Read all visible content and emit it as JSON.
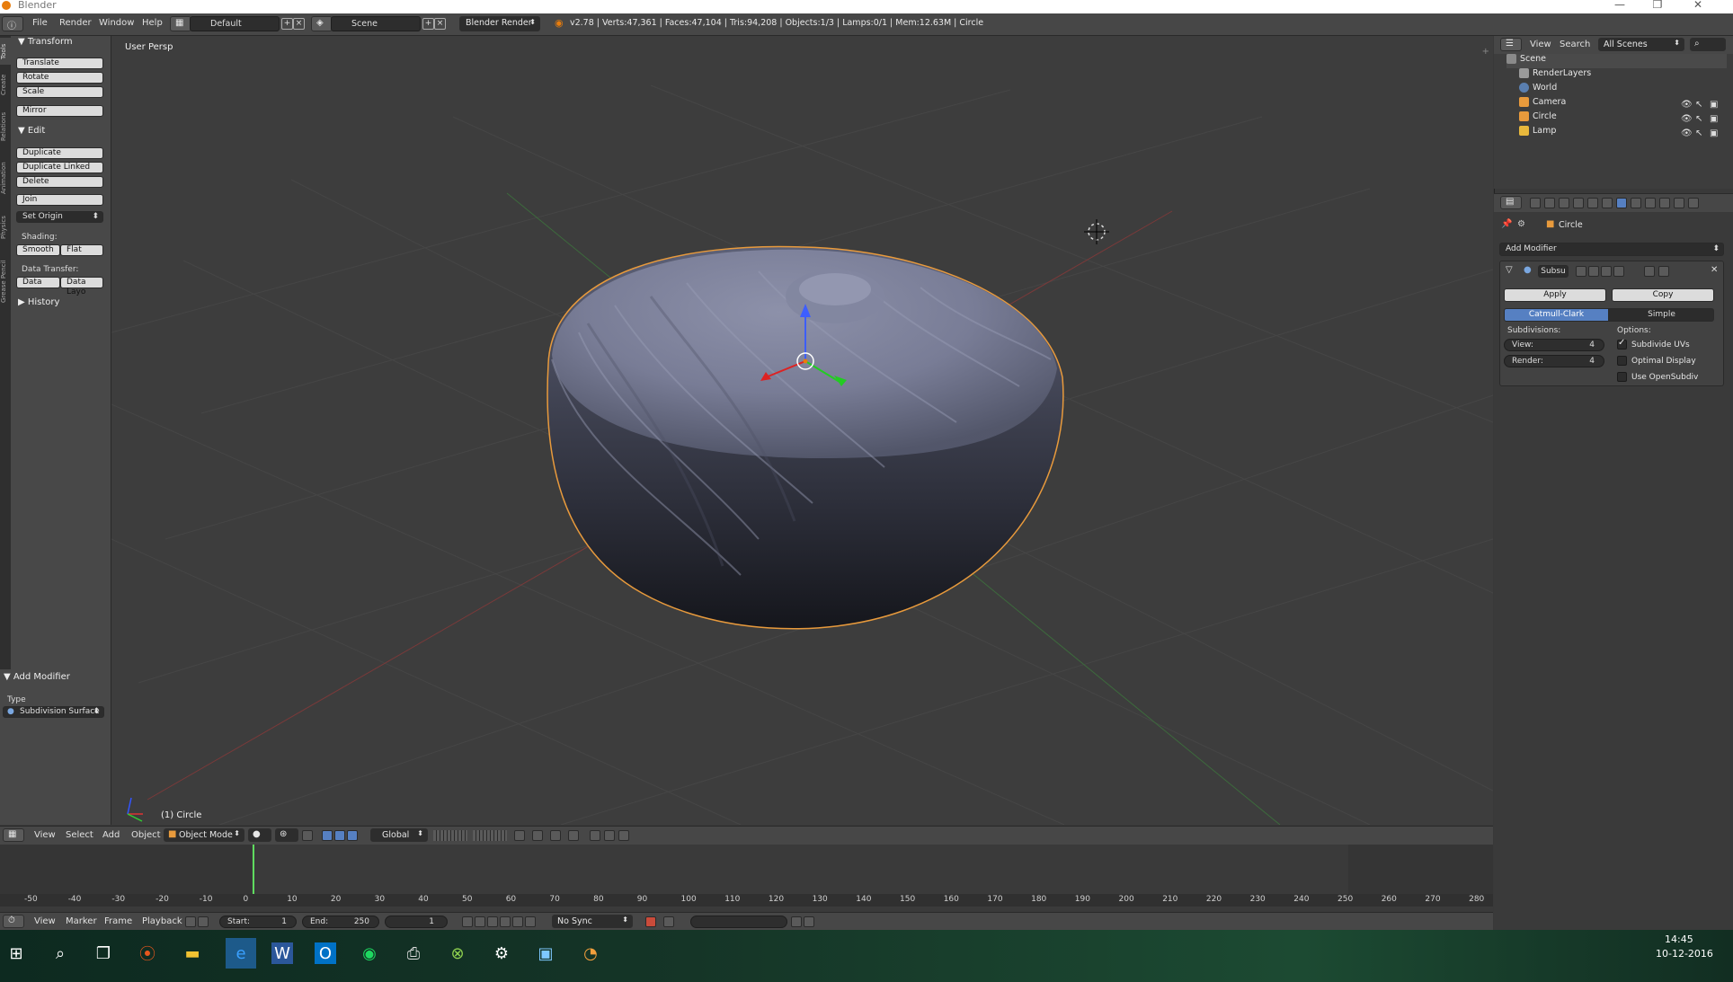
{
  "window": {
    "title": "Blender"
  },
  "info_header": {
    "menus": [
      "File",
      "Render",
      "Window",
      "Help"
    ],
    "layout": "Default",
    "scene": "Scene",
    "engine": "Blender Render",
    "stats": "v2.78 | Verts:47,361 | Faces:47,104 | Tris:94,208 | Objects:1/3 | Lamps:0/1 | Mem:12.63M | Circle"
  },
  "tool_tabs": [
    "Tools",
    "Create",
    "Relations",
    "Animation",
    "Physics",
    "Grease Pencil"
  ],
  "toolshelf": {
    "transform": {
      "title": "Transform",
      "buttons": [
        "Translate",
        "Rotate",
        "Scale",
        "Mirror"
      ]
    },
    "edit": {
      "title": "Edit",
      "buttons": [
        "Duplicate",
        "Duplicate Linked",
        "Delete",
        "Join"
      ],
      "set_origin": "Set Origin",
      "shading_label": "Shading:",
      "smooth": "Smooth",
      "flat": "Flat",
      "data_transfer_label": "Data Transfer:",
      "data": "Data",
      "data_layo": "Data Layo"
    },
    "history": {
      "title": "History"
    },
    "operator": {
      "title": "Add Modifier",
      "type_label": "Type",
      "type_value": "Subdivision Surface"
    }
  },
  "viewport": {
    "view_name": "User Persp",
    "object_label": "(1) Circle"
  },
  "view3d_header": {
    "menus": [
      "View",
      "Select",
      "Add",
      "Object"
    ],
    "mode": "Object Mode",
    "orientation": "Global"
  },
  "timeline": {
    "ruler_ticks": [
      "-50",
      "-40",
      "-30",
      "-20",
      "-10",
      "0",
      "10",
      "20",
      "30",
      "40",
      "50",
      "60",
      "70",
      "80",
      "90",
      "100",
      "110",
      "120",
      "130",
      "140",
      "150",
      "160",
      "170",
      "180",
      "190",
      "200",
      "210",
      "220",
      "230",
      "240",
      "250",
      "260",
      "270",
      "280"
    ],
    "menus": [
      "View",
      "Marker",
      "Frame",
      "Playback"
    ],
    "start_label": "Start:",
    "start": "1",
    "end_label": "End:",
    "end": "250",
    "current": "1",
    "sync": "No Sync"
  },
  "outliner": {
    "menus": [
      "View",
      "Search"
    ],
    "filter": "All Scenes",
    "items": [
      {
        "label": "Scene",
        "color": "#8a8a8a"
      },
      {
        "label": "RenderLayers",
        "color": "#9a9a9a"
      },
      {
        "label": "World",
        "color": "#5a7fb0"
      },
      {
        "label": "Camera",
        "color": "#e89a3c"
      },
      {
        "label": "Circle",
        "color": "#e89a3c"
      },
      {
        "label": "Lamp",
        "color": "#e8b83c"
      }
    ]
  },
  "properties": {
    "object_name": "Circle",
    "add_modifier": "Add Modifier",
    "modifier_name": "Subsu",
    "apply": "Apply",
    "copy": "Copy",
    "catmull": "Catmull-Clark",
    "simple": "Simple",
    "subdivisions_label": "Subdivisions:",
    "view_label": "View:",
    "view_value": "4",
    "render_label": "Render:",
    "render_value": "4",
    "options_label": "Options:",
    "subdivide_uvs": "Subdivide UVs",
    "optimal_display": "Optimal Display",
    "use_opensubdiv": "Use OpenSubdiv"
  },
  "taskbar": {
    "time": "14:45",
    "date": "10-12-2016",
    "apps": [
      "start-icon",
      "search-icon",
      "task-view-icon",
      "ubuntu-icon",
      "file-explorer-icon",
      "edge-icon",
      "word-icon",
      "outlook-icon",
      "spotify-icon",
      "printer-icon",
      "xbox-icon",
      "settings-icon",
      "network-icon",
      "blender-icon"
    ]
  }
}
